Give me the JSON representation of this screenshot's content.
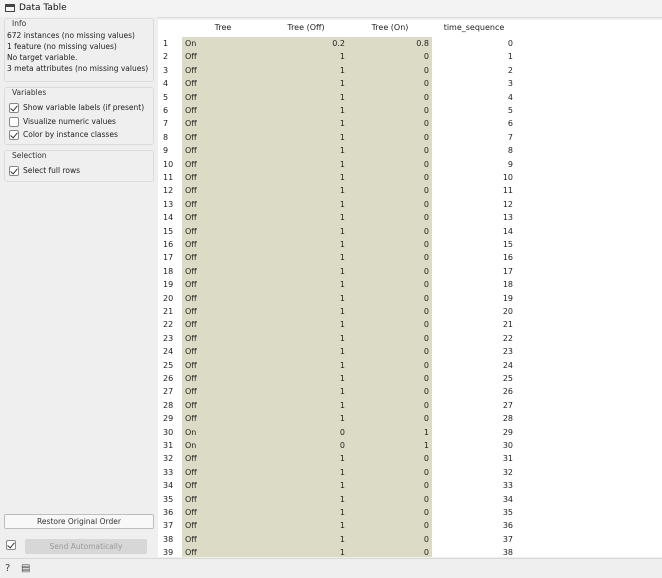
{
  "window": {
    "title": "Data Table"
  },
  "info": {
    "title": "Info",
    "lines": [
      "672 instances (no missing values)",
      "1 feature (no missing values)",
      "No target variable.",
      "3 meta attributes (no missing values)"
    ]
  },
  "variables": {
    "title": "Variables",
    "options": [
      {
        "label": "Show variable labels (if present)",
        "checked": true
      },
      {
        "label": "Visualize numeric values",
        "checked": false
      },
      {
        "label": "Color by instance classes",
        "checked": true
      }
    ]
  },
  "selection": {
    "title": "Selection",
    "options": [
      {
        "label": "Select full rows",
        "checked": true
      }
    ]
  },
  "buttons": {
    "restore": "Restore Original Order",
    "send": "Send Automatically"
  },
  "table": {
    "columns": [
      "Tree",
      "Tree (Off)",
      "Tree (On)",
      "time_sequence"
    ],
    "rows": [
      [
        "1",
        "On",
        "0.2",
        "0.8",
        "0"
      ],
      [
        "2",
        "Off",
        "1",
        "0",
        "1"
      ],
      [
        "3",
        "Off",
        "1",
        "0",
        "2"
      ],
      [
        "4",
        "Off",
        "1",
        "0",
        "3"
      ],
      [
        "5",
        "Off",
        "1",
        "0",
        "4"
      ],
      [
        "6",
        "Off",
        "1",
        "0",
        "5"
      ],
      [
        "7",
        "Off",
        "1",
        "0",
        "6"
      ],
      [
        "8",
        "Off",
        "1",
        "0",
        "7"
      ],
      [
        "9",
        "Off",
        "1",
        "0",
        "8"
      ],
      [
        "10",
        "Off",
        "1",
        "0",
        "9"
      ],
      [
        "11",
        "Off",
        "1",
        "0",
        "10"
      ],
      [
        "12",
        "Off",
        "1",
        "0",
        "11"
      ],
      [
        "13",
        "Off",
        "1",
        "0",
        "12"
      ],
      [
        "14",
        "Off",
        "1",
        "0",
        "13"
      ],
      [
        "15",
        "Off",
        "1",
        "0",
        "14"
      ],
      [
        "16",
        "Off",
        "1",
        "0",
        "15"
      ],
      [
        "17",
        "Off",
        "1",
        "0",
        "16"
      ],
      [
        "18",
        "Off",
        "1",
        "0",
        "17"
      ],
      [
        "19",
        "Off",
        "1",
        "0",
        "18"
      ],
      [
        "20",
        "Off",
        "1",
        "0",
        "19"
      ],
      [
        "21",
        "Off",
        "1",
        "0",
        "20"
      ],
      [
        "22",
        "Off",
        "1",
        "0",
        "21"
      ],
      [
        "23",
        "Off",
        "1",
        "0",
        "22"
      ],
      [
        "24",
        "Off",
        "1",
        "0",
        "23"
      ],
      [
        "25",
        "Off",
        "1",
        "0",
        "24"
      ],
      [
        "26",
        "Off",
        "1",
        "0",
        "25"
      ],
      [
        "27",
        "Off",
        "1",
        "0",
        "26"
      ],
      [
        "28",
        "Off",
        "1",
        "0",
        "27"
      ],
      [
        "29",
        "Off",
        "1",
        "0",
        "28"
      ],
      [
        "30",
        "On",
        "0",
        "1",
        "29"
      ],
      [
        "31",
        "On",
        "0",
        "1",
        "30"
      ],
      [
        "32",
        "Off",
        "1",
        "0",
        "31"
      ],
      [
        "33",
        "Off",
        "1",
        "0",
        "32"
      ],
      [
        "34",
        "Off",
        "1",
        "0",
        "33"
      ],
      [
        "35",
        "Off",
        "1",
        "0",
        "34"
      ],
      [
        "36",
        "Off",
        "1",
        "0",
        "35"
      ],
      [
        "37",
        "Off",
        "1",
        "0",
        "36"
      ],
      [
        "38",
        "Off",
        "1",
        "0",
        "37"
      ],
      [
        "39",
        "Off",
        "1",
        "0",
        "38"
      ]
    ]
  },
  "status": {
    "icons": [
      "help-icon",
      "report-icon"
    ],
    "help_glyph": "?",
    "report_glyph": "▤"
  }
}
